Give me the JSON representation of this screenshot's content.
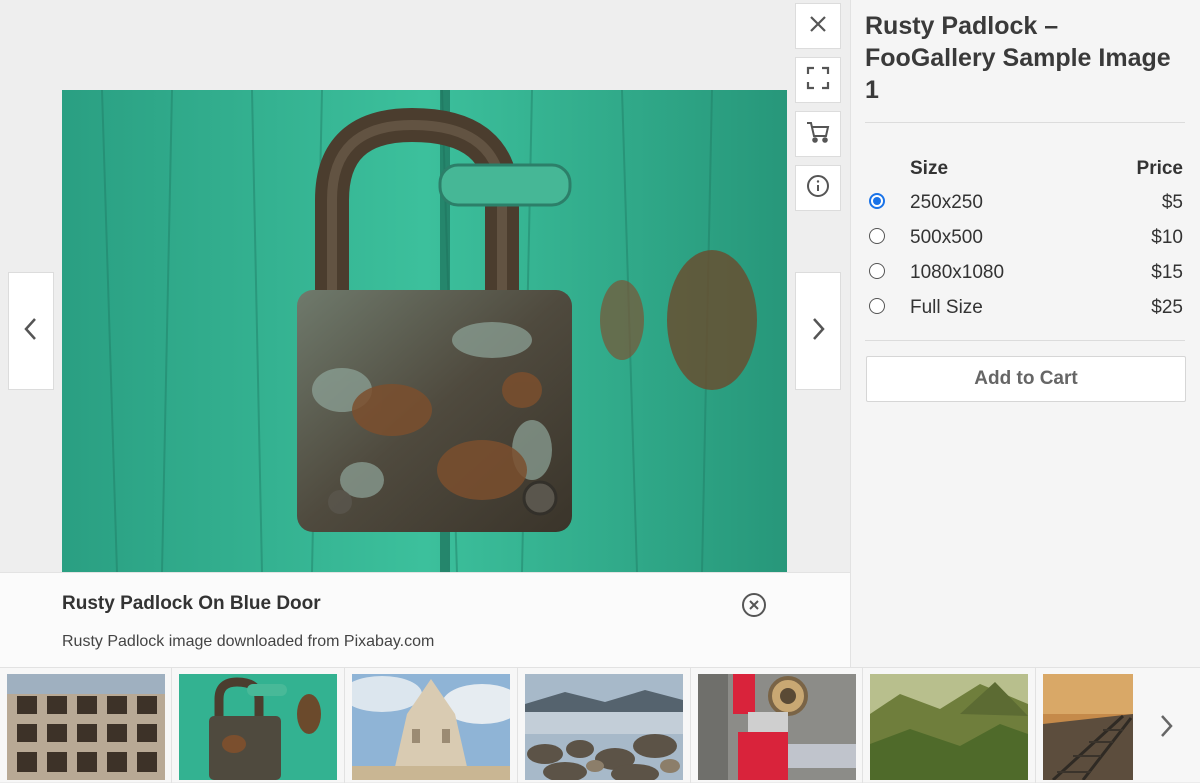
{
  "product": {
    "title": "Rusty Padlock – FooGallery Sample Image 1"
  },
  "caption": {
    "title": "Rusty Padlock On Blue Door",
    "description": "Rusty Padlock image downloaded from Pixabay.com"
  },
  "pricing": {
    "header_size": "Size",
    "header_price": "Price",
    "rows": [
      {
        "size": "250x250",
        "price": "$5",
        "selected": true
      },
      {
        "size": "500x500",
        "price": "$10",
        "selected": false
      },
      {
        "size": "1080x1080",
        "price": "$15",
        "selected": false
      },
      {
        "size": "Full Size",
        "price": "$25",
        "selected": false
      }
    ]
  },
  "add_to_cart_label": "Add to Cart",
  "toolbar": {
    "icons": [
      "close-icon",
      "fullscreen-icon",
      "cart-icon",
      "info-icon"
    ]
  },
  "thumbnails": [
    {
      "name": "abandoned-building"
    },
    {
      "name": "rusty-padlock",
      "active": true
    },
    {
      "name": "sand-castle"
    },
    {
      "name": "rocky-shore"
    },
    {
      "name": "red-pipe-valve"
    },
    {
      "name": "green-mountains"
    },
    {
      "name": "railway-tracks"
    }
  ],
  "colors": {
    "accent": "#1a73e8",
    "door_green": "#2fae8e"
  }
}
